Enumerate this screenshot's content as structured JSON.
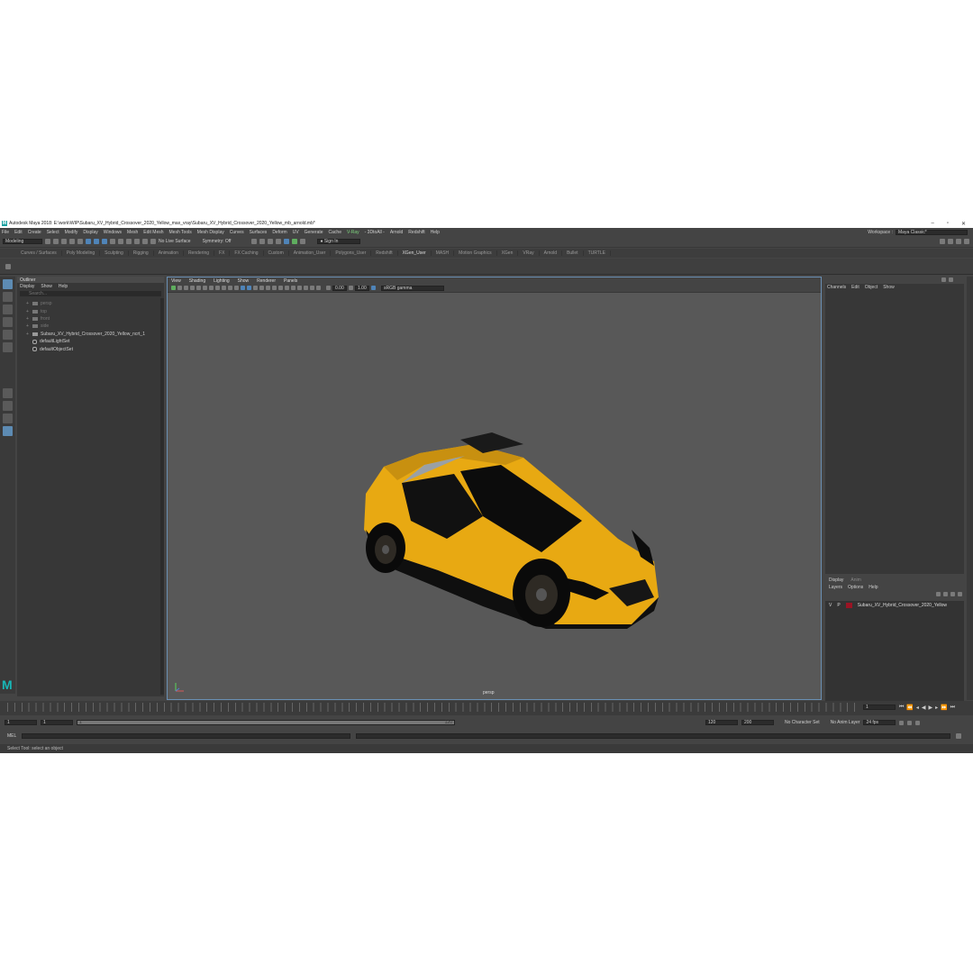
{
  "title_bar": {
    "app_title": "Autodesk Maya 2018: E:\\work\\WIP\\Subaru_XV_Hybrid_Crossover_2020_Yellow_max_vray\\Subaru_XV_Hybrid_Crossover_2020_Yellow_mb_arnold.mb*",
    "logo": "M"
  },
  "menus": [
    "File",
    "Edit",
    "Create",
    "Select",
    "Modify",
    "Display",
    "Windows",
    "Mesh",
    "Edit Mesh",
    "Mesh Tools",
    "Mesh Display",
    "Curves",
    "Surfaces",
    "Deform",
    "UV",
    "Generate",
    "Cache"
  ],
  "menus_extra": [
    "- 3DtoAll -",
    "Arnold",
    "Redshift",
    "Help"
  ],
  "vray_menu": "V-Ray",
  "workspace": {
    "label": "Workspace :",
    "value": "Maya Classic*"
  },
  "status_line": {
    "mode": "Modeling",
    "live_surface": "No Live Surface",
    "symmetry": "Symmetry: Off",
    "sign_in": "Sign In"
  },
  "shelf_tabs": [
    "Curves / Surfaces",
    "Poly Modeling",
    "Sculpting",
    "Rigging",
    "Animation",
    "Rendering",
    "FX",
    "FX Caching",
    "Custom",
    "Animation_User",
    "Polygons_User",
    "Redshift",
    "XGen_User",
    "MASH",
    "Motion Graphics",
    "XGen",
    "VRay",
    "Arnold",
    "Bullet",
    "TURTLE"
  ],
  "shelf_active": "XGen_User",
  "outliner": {
    "title": "Outliner",
    "menu": [
      "Display",
      "Show",
      "Help"
    ],
    "search_placeholder": "Search...",
    "items": [
      {
        "label": "persp",
        "kind": "camera",
        "dim": true
      },
      {
        "label": "top",
        "kind": "camera",
        "dim": true
      },
      {
        "label": "front",
        "kind": "camera",
        "dim": true
      },
      {
        "label": "side",
        "kind": "camera",
        "dim": true
      },
      {
        "label": "Subaru_XV_Hybrid_Crossover_2020_Yellow_ncrt_1",
        "kind": "group",
        "dim": false
      },
      {
        "label": "defaultLightSet",
        "kind": "set",
        "dim": false
      },
      {
        "label": "defaultObjectSet",
        "kind": "set",
        "dim": false
      }
    ]
  },
  "viewport": {
    "menu": [
      "View",
      "Shading",
      "Lighting",
      "Show",
      "Renderer",
      "Panels"
    ],
    "exposure": "0.00",
    "gamma": "1.00",
    "color_space": "sRGB gamma",
    "camera_label": "persp",
    "car_color": "#e8a912"
  },
  "channel_box": {
    "menu": [
      "Channels",
      "Edit",
      "Object",
      "Show"
    ]
  },
  "layer_editor": {
    "tabs": [
      "Display",
      "Anim"
    ],
    "menu": [
      "Layers",
      "Options",
      "Help"
    ],
    "layer": {
      "v": "V",
      "p": "P",
      "name": "Subaru_XV_Hybrid_Crossover_2020_Yellow",
      "color": "#9a1424"
    }
  },
  "time": {
    "current_frame": "1",
    "range_start": "1",
    "range_start_inner": "1",
    "slider_start": "1",
    "slider_end": "120",
    "range_end": "120",
    "anim_end": "200",
    "character_set": "No Character Set",
    "anim_layer": "No Anim Layer",
    "fps": "24 fps"
  },
  "command_line": {
    "lang": "MEL"
  },
  "help_line": "Select Tool: select an object"
}
